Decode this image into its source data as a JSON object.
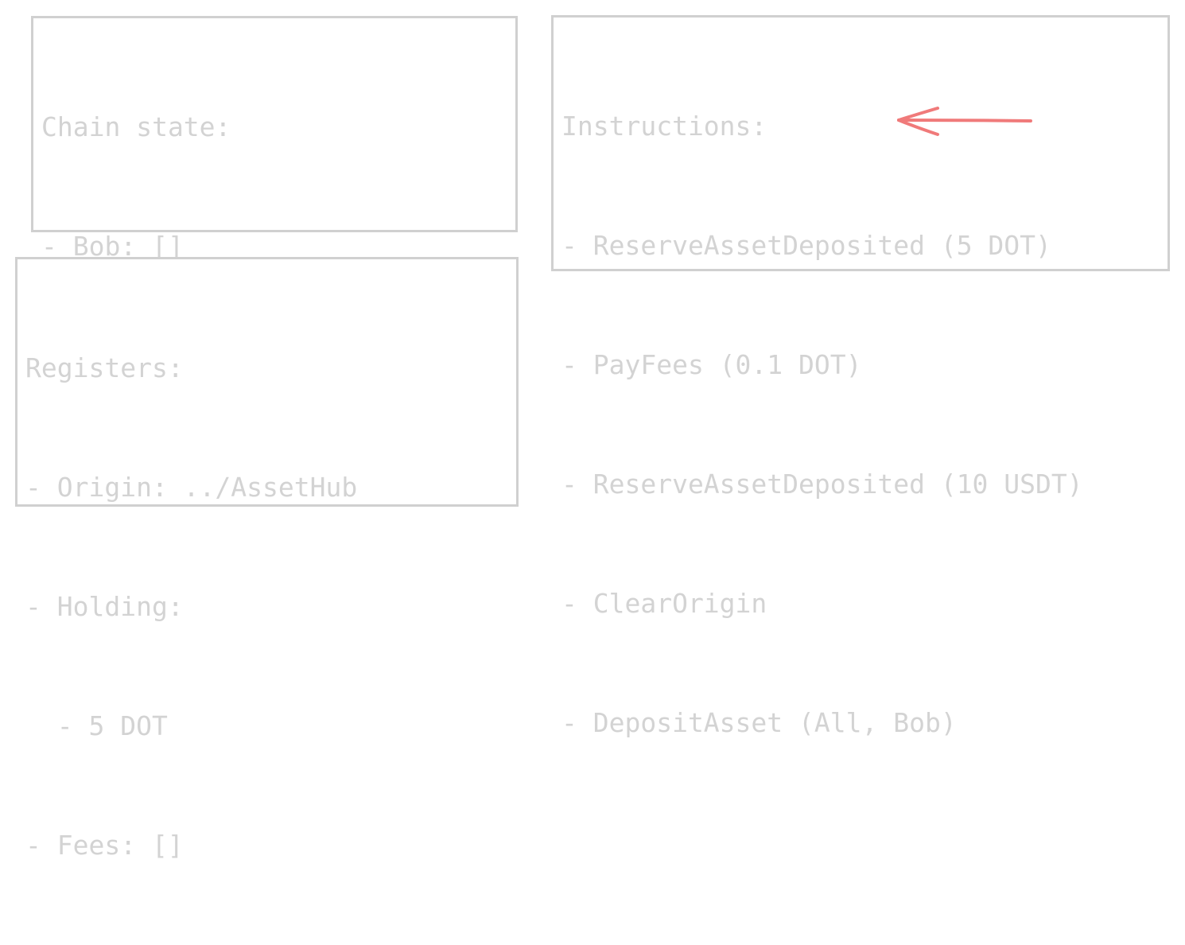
{
  "chain_state": {
    "title": "Chain state:",
    "lines": [
      "- Bob: []"
    ]
  },
  "registers": {
    "title": "Registers:",
    "lines": [
      "- Origin: ../AssetHub",
      "- Holding:",
      "  - 5 DOT",
      "- Fees: []"
    ]
  },
  "instructions": {
    "title": "Instructions:",
    "items": [
      "- ReserveAssetDeposited (5 DOT)",
      "- PayFees (0.1 DOT)",
      "- ReserveAssetDeposited (10 USDT)",
      "- ClearOrigin",
      "- DepositAsset (All, Bob)"
    ],
    "current_index": 1
  },
  "colors": {
    "text": "#d3d3d3",
    "border": "#d0d0d0",
    "pointer_arrow": "#f07a7a"
  },
  "icons": {
    "pointer": "arrow-left-icon"
  }
}
